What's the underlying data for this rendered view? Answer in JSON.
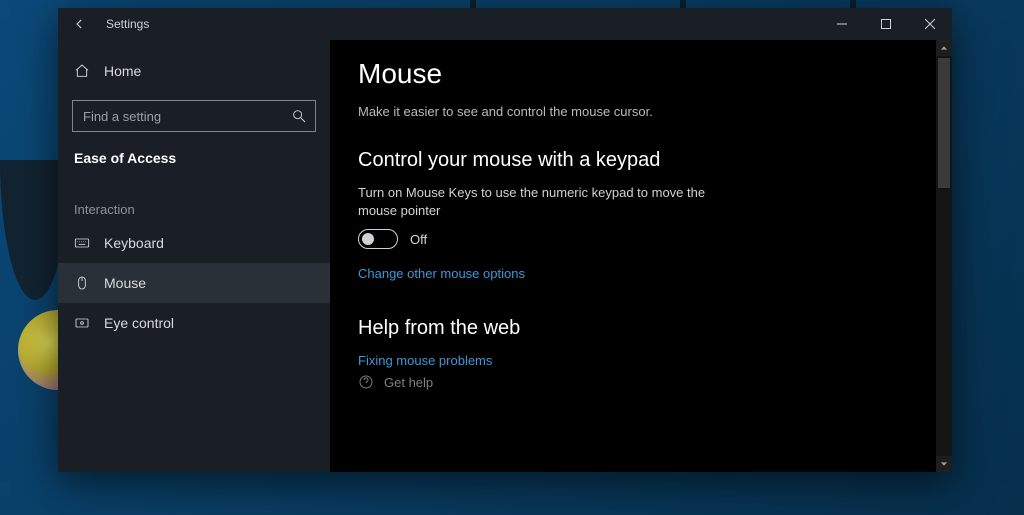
{
  "window": {
    "title": "Settings"
  },
  "sidebar": {
    "home": "Home",
    "search_placeholder": "Find a setting",
    "category": "Ease of Access",
    "group": "Interaction",
    "items": [
      {
        "label": "Keyboard"
      },
      {
        "label": "Mouse"
      },
      {
        "label": "Eye control"
      }
    ],
    "selected_index": 1
  },
  "page": {
    "title": "Mouse",
    "description": "Make it easier to see and control the mouse cursor."
  },
  "section_keypad": {
    "heading": "Control your mouse with a keypad",
    "toggle_description": "Turn on Mouse Keys to use the numeric keypad to move the mouse pointer",
    "toggle_state_label": "Off",
    "link": "Change other mouse options"
  },
  "section_help": {
    "heading": "Help from the web",
    "link": "Fixing mouse problems",
    "gethelp": "Get help"
  }
}
